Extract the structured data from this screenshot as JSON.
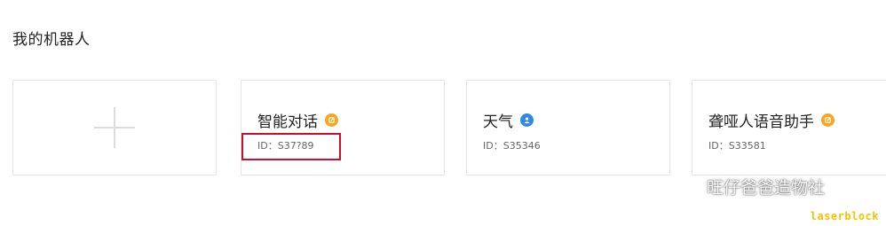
{
  "page_title": "我的机器人",
  "add_card": {
    "icon": "plus-icon"
  },
  "bots": [
    {
      "name": "智能对话",
      "id_text": "ID：S37?89",
      "badge_color": "#f5a623",
      "badge_icon": "edit-badge-icon"
    },
    {
      "name": "天气",
      "id_text": "ID：S35346",
      "badge_color": "#2f8ae5",
      "badge_icon": "user-badge-icon"
    },
    {
      "name": "聋哑人语音助手",
      "id_text": "ID：S33581",
      "badge_color": "#f5a623",
      "badge_icon": "edit-badge-icon"
    }
  ],
  "watermark": {
    "icon": "wechat-icon",
    "text": "旺仔爸爸造物社"
  },
  "brand_mark": "laserblock"
}
